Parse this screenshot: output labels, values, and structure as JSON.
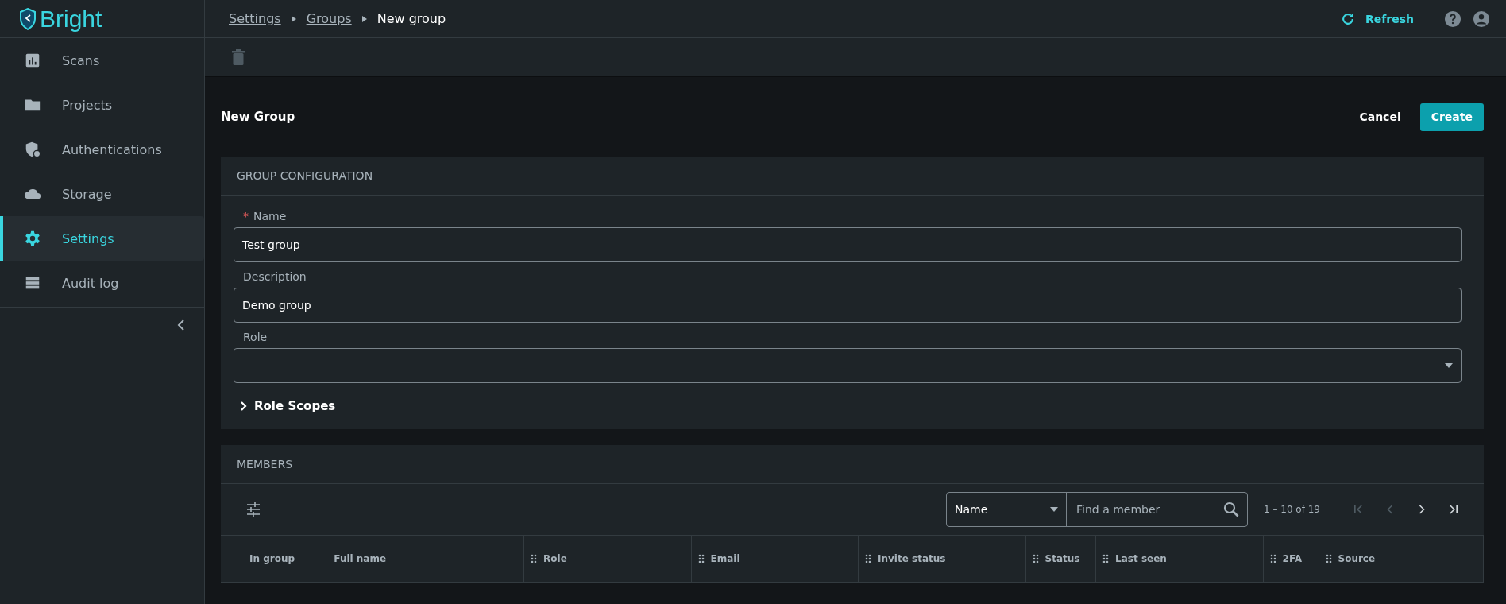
{
  "logo": {
    "text": "Bright"
  },
  "sidebar": {
    "items": [
      {
        "label": "Scans",
        "selected": false
      },
      {
        "label": "Projects",
        "selected": false
      },
      {
        "label": "Authentications",
        "selected": false
      },
      {
        "label": "Storage",
        "selected": false
      },
      {
        "label": "Settings",
        "selected": true
      },
      {
        "label": "Audit log",
        "selected": false
      }
    ]
  },
  "breadcrumbs": [
    {
      "label": "Settings",
      "kind": "link"
    },
    {
      "label": "Groups",
      "kind": "link"
    },
    {
      "label": "New group",
      "kind": "current"
    }
  ],
  "header_actions": {
    "refresh": "Refresh"
  },
  "toolbar": {
    "delete_disabled": true
  },
  "page": {
    "title": "New Group",
    "cancel": "Cancel",
    "create": "Create"
  },
  "group_configuration": {
    "title": "GROUP CONFIGURATION",
    "fields": [
      {
        "kind": "text",
        "required_mark": "*",
        "label": "Name",
        "value": "Test group"
      },
      {
        "kind": "text",
        "label": "Description",
        "value": "Demo group"
      },
      {
        "kind": "select",
        "label": "Role"
      }
    ],
    "role_scopes": {
      "label": "Role Scopes",
      "expanded": false
    }
  },
  "members": {
    "title": "MEMBERS",
    "filter_field": "Name",
    "search": {
      "placeholder": "Find a member"
    },
    "range": "1 – 10 of 19",
    "pager": [
      {
        "kind": "first",
        "disabled": true
      },
      {
        "kind": "prev",
        "disabled": true
      },
      {
        "kind": "next",
        "disabled": false
      },
      {
        "kind": "last",
        "disabled": false
      }
    ],
    "columns": [
      {
        "label": "In group",
        "kind": "fixed"
      },
      {
        "label": "Full name",
        "kind": "fixed"
      },
      {
        "label": "Role",
        "kind": "movable"
      },
      {
        "label": "Email",
        "kind": "movable"
      },
      {
        "label": "Invite status",
        "kind": "movable"
      },
      {
        "label": "Status",
        "kind": "movable"
      },
      {
        "label": "Last seen",
        "kind": "movable"
      },
      {
        "label": "2FA",
        "kind": "movable"
      },
      {
        "label": "Source",
        "kind": "movable"
      }
    ]
  }
}
